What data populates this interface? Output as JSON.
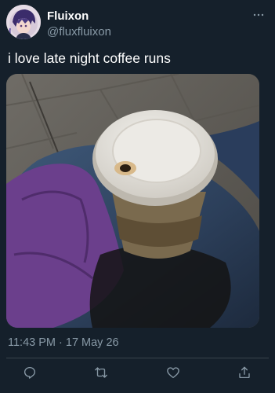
{
  "author": {
    "display_name": "Fluixon",
    "handle": "@fluxfluixon"
  },
  "tweet": {
    "text": "i love late night coffee runs",
    "timestamp": "11:43 PM · 17 May 26"
  },
  "media": {
    "description_icon": "photo"
  },
  "actions": {
    "reply_icon": "reply-icon",
    "retweet_icon": "retweet-icon",
    "like_icon": "heart-icon",
    "share_icon": "share-icon"
  },
  "colors": {
    "background": "#15202b",
    "secondary_text": "#8899a6",
    "divider": "#38444d"
  }
}
